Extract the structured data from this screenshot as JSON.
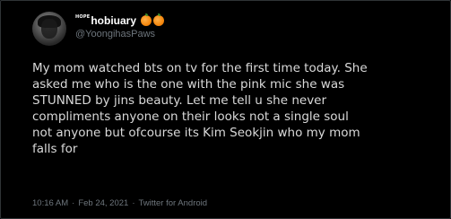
{
  "tweet": {
    "hope_tag": "HOPE",
    "display_name": "hobiuary",
    "handle": "@YoongihasPaws",
    "text": "My mom watched bts on tv for the first time today. She\nasked me who is the one with the pink mic she was\nSTUNNED by jins beauty. Let me tell u she never\ncompliments anyone on their looks not a single soul\nnot anyone but ofcourse its Kim Seokjin who my mom\nfalls for",
    "time": "10:16 AM",
    "date": "Feb 24, 2021",
    "separator": "·",
    "source": "Twitter for Android",
    "emojis": [
      "tangerine-emoji",
      "tangerine-emoji"
    ]
  },
  "colors": {
    "background": "#000000",
    "text": "#d9d9d9",
    "muted": "#6e767d",
    "name": "#ffffff",
    "border": "#2f3336"
  }
}
